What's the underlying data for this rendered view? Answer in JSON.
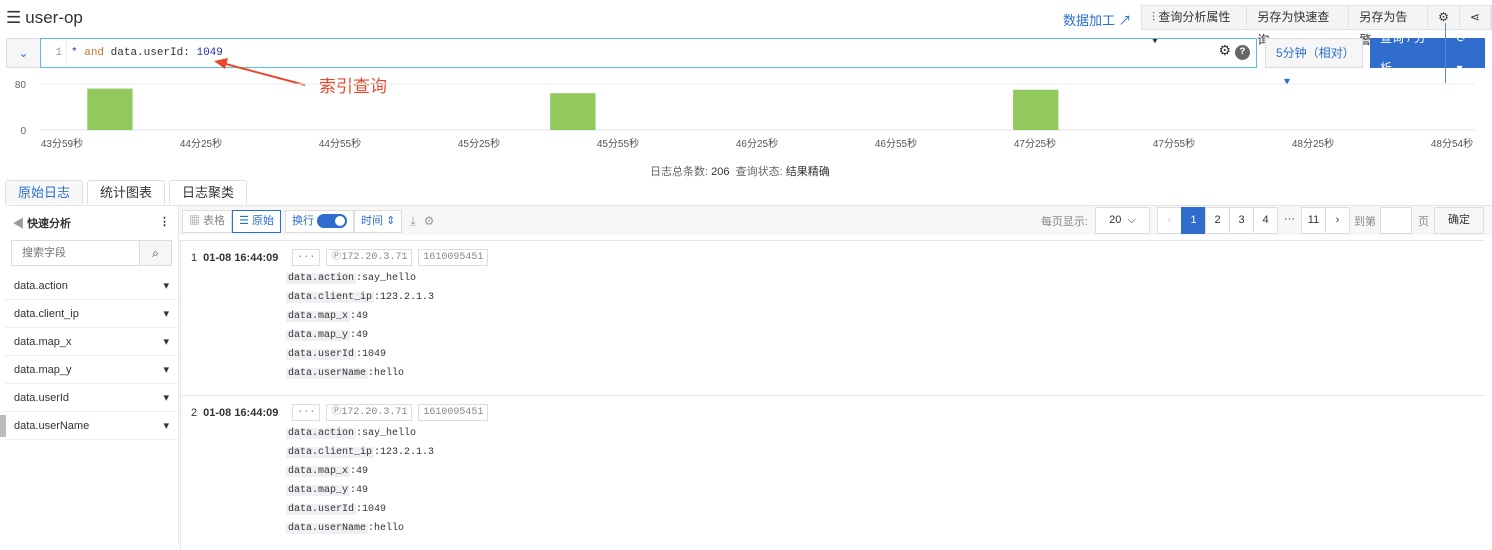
{
  "header": {
    "title": "user-op",
    "data_process": "数据加工",
    "buttons": [
      "查询分析属性",
      "另存为快速查询",
      "另存为告警"
    ]
  },
  "query": {
    "line": "1",
    "star": "*",
    "and": "and",
    "field": "data.userId:",
    "value": "1049",
    "time_range": "5分钟（相对）",
    "search": "查询 / 分析",
    "help": "?"
  },
  "annotation": "索引查询",
  "chart_data": {
    "type": "bar",
    "ylim": [
      0,
      80
    ],
    "yticks": [
      "80",
      "0"
    ],
    "xticks": [
      "43分59秒",
      "44分25秒",
      "44分55秒",
      "45分25秒",
      "45分55秒",
      "46分25秒",
      "46分55秒",
      "47分25秒",
      "47分55秒",
      "48分25秒",
      "48分54秒"
    ],
    "values": [
      0,
      72,
      0,
      0,
      0,
      0,
      0,
      0,
      0,
      0,
      0,
      64,
      0,
      0,
      0,
      0,
      0,
      0,
      0,
      0,
      0,
      70,
      0,
      0,
      0,
      0,
      0,
      0,
      0,
      0,
      0
    ],
    "color": "#91c95e"
  },
  "summary": {
    "total_label": "日志总条数:",
    "total": "206",
    "status_label": "查询状态:",
    "status": "结果精确"
  },
  "tabs": [
    "原始日志",
    "统计图表",
    "日志聚类"
  ],
  "sidebar": {
    "title": "快速分析",
    "search_placeholder": "搜索字段",
    "fields": [
      "data.action",
      "data.client_ip",
      "data.map_x",
      "data.map_y",
      "data.userId",
      "data.userName"
    ]
  },
  "toolbar": {
    "table": "表格",
    "raw": "原始",
    "wrap": "换行",
    "time": "时间"
  },
  "pagination": {
    "per_page_label": "每页显示:",
    "per_page": "20",
    "pages": [
      "1",
      "2",
      "3",
      "4",
      "···",
      "11"
    ],
    "goto": "到第",
    "page_unit": "页",
    "confirm": "确定"
  },
  "records": [
    {
      "index": "1",
      "time": "01-08 16:44:09",
      "ip": "172.20.3.71",
      "ts": "1610095451",
      "fields": [
        [
          "data.action",
          ":say_hello"
        ],
        [
          "data.client_ip",
          ":123.2.1.3"
        ],
        [
          "data.map_x",
          ":49"
        ],
        [
          "data.map_y",
          ":49"
        ],
        [
          "data.userId",
          ":1049"
        ],
        [
          "data.userName",
          ":hello"
        ]
      ]
    },
    {
      "index": "2",
      "time": "01-08 16:44:09",
      "ip": "172.20.3.71",
      "ts": "1610095451",
      "fields": [
        [
          "data.action",
          ":say_hello"
        ],
        [
          "data.client_ip",
          ":123.2.1.3"
        ],
        [
          "data.map_x",
          ":49"
        ],
        [
          "data.map_y",
          ":49"
        ],
        [
          "data.userId",
          ":1049"
        ],
        [
          "data.userName",
          ":hello"
        ]
      ]
    }
  ]
}
